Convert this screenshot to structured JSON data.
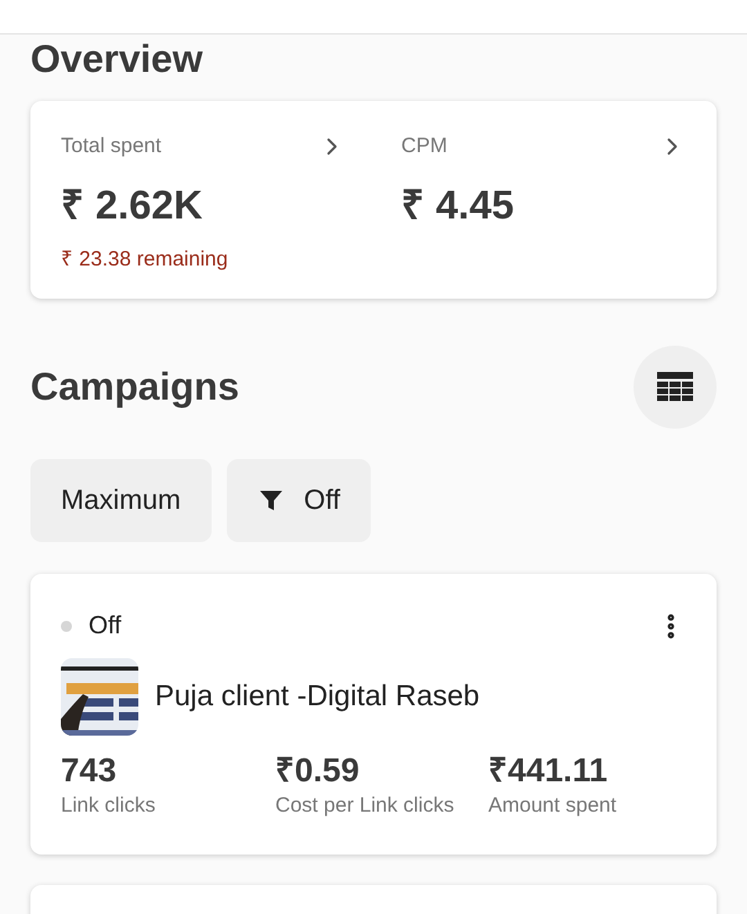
{
  "overview": {
    "title": "Overview",
    "metrics": [
      {
        "label": "Total spent",
        "value": "₹ 2.62K",
        "note": "₹ 23.38 remaining"
      },
      {
        "label": "CPM",
        "value": "₹ 4.45"
      }
    ]
  },
  "campaigns": {
    "title": "Campaigns",
    "filters": [
      {
        "kind": "plain",
        "label": "Maximum"
      },
      {
        "kind": "filter",
        "label": "Off"
      }
    ],
    "items": [
      {
        "status": "Off",
        "color": "#d6d6d6",
        "name": "Puja client -Digital Raseb",
        "stats": [
          {
            "value": "743",
            "label": "Link clicks"
          },
          {
            "value": "₹0.59",
            "label": "Cost per Link clicks"
          },
          {
            "value": "₹441.11",
            "label": "Amount spent"
          }
        ]
      }
    ]
  }
}
